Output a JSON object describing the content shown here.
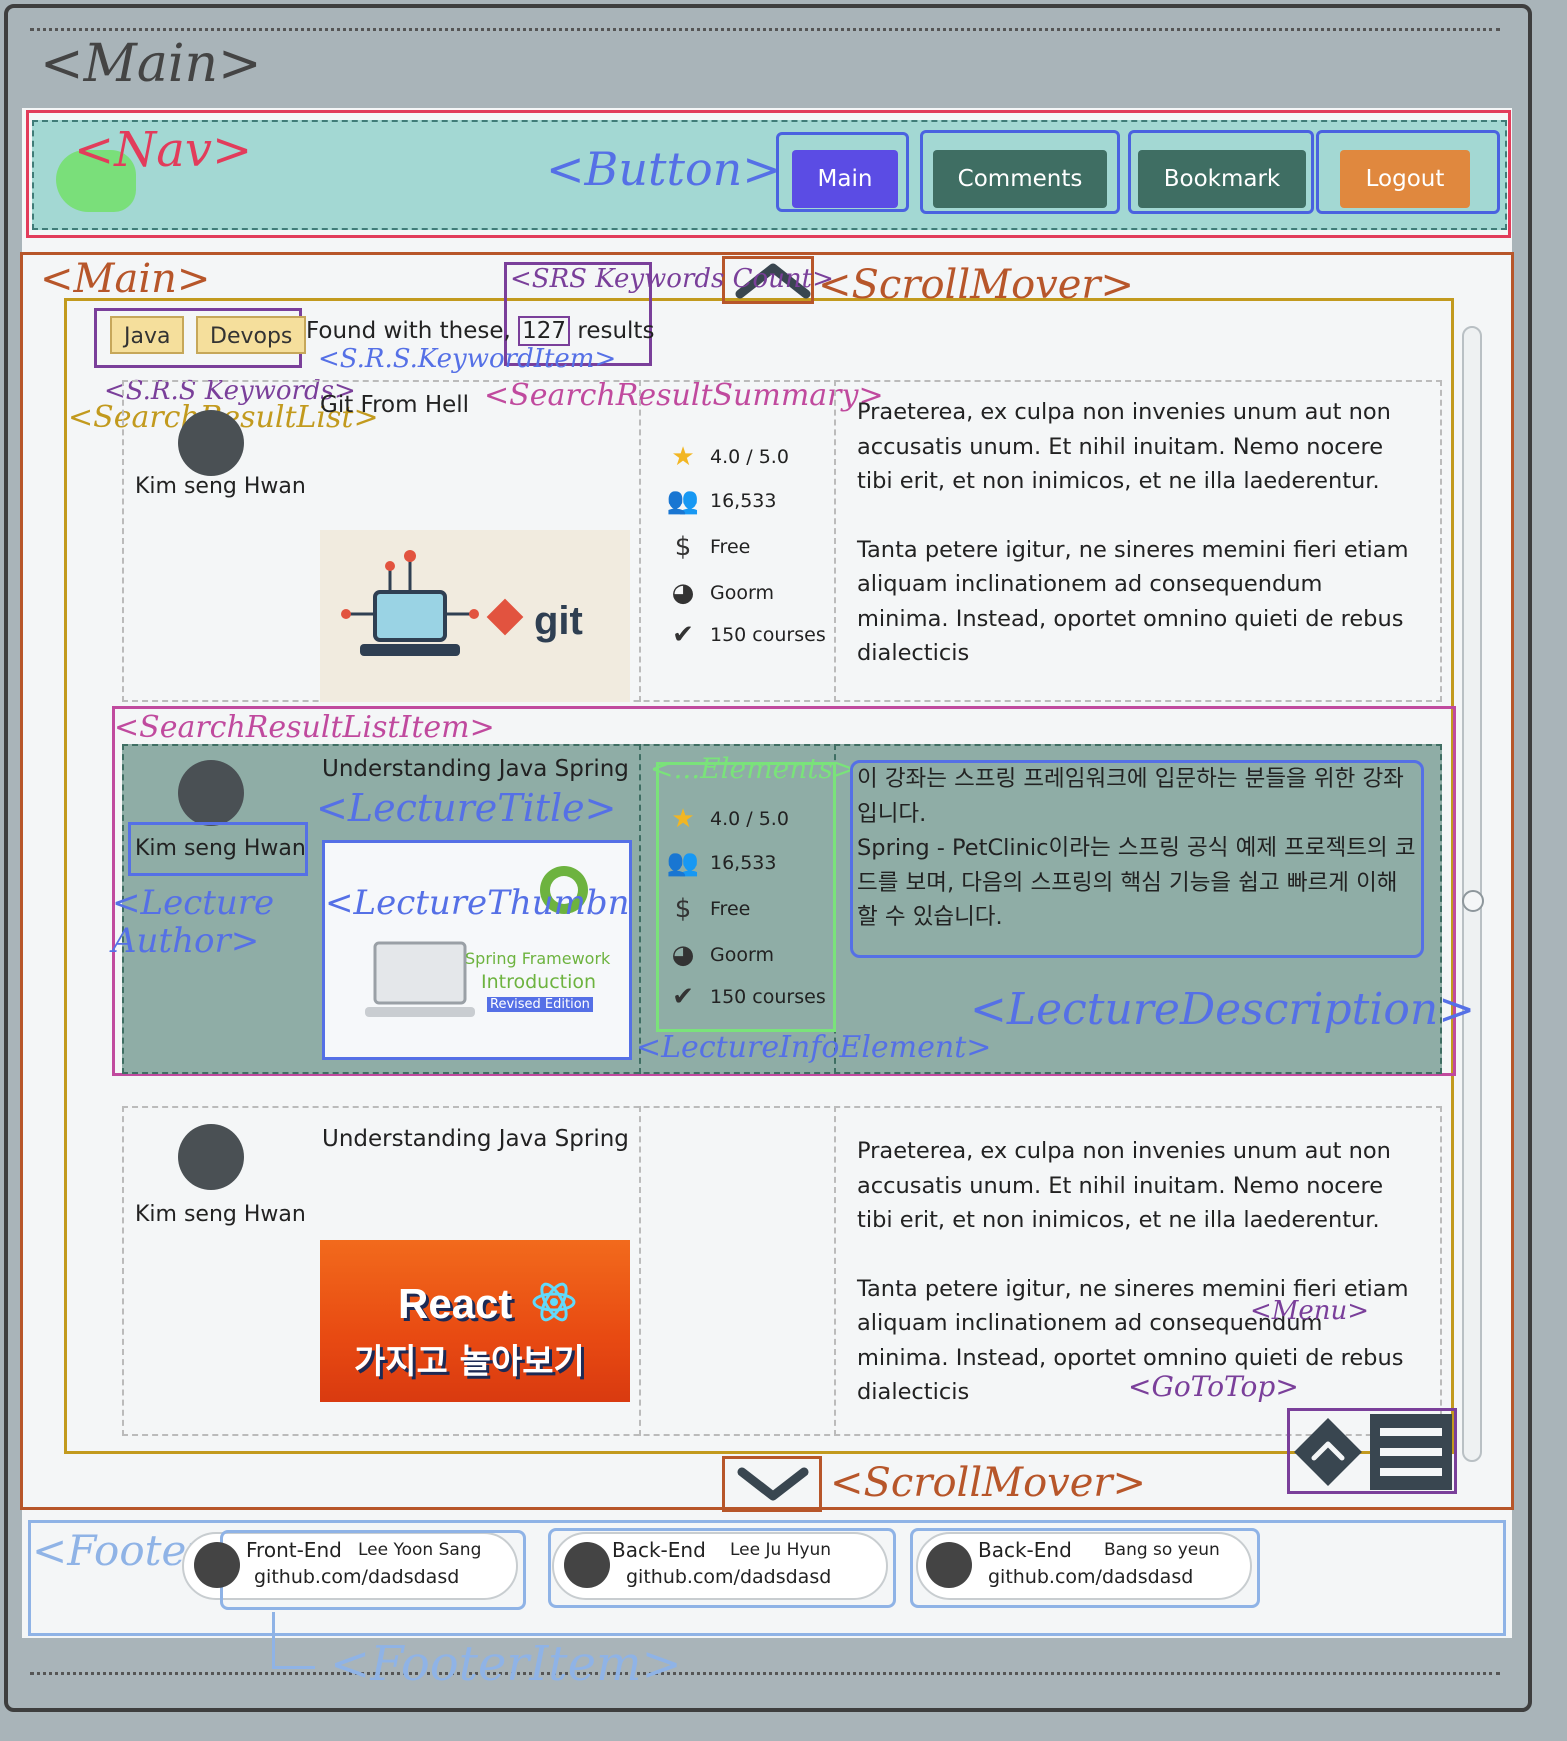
{
  "annotations": {
    "main_outer": "<Main>",
    "nav": "<Nav>",
    "button": "<Button>",
    "main": "<Main>",
    "srs_keywords_count": "<SRS Keywords Count>",
    "scroll_mover_top": "<ScrollMover>",
    "srs_keyword_item": "<S.R.S.KeywordItem>",
    "srs_keywords": "<S.R.S Keywords>",
    "search_result_list": "<SearchResultList>",
    "search_result_summary": "<SearchResultSummary>",
    "search_result_list_item": "<SearchResultListItem>",
    "lecture_title": "<LectureTitle>",
    "elements": "<...Elements>",
    "lecture_author": "<Lecture Author>",
    "lecture_thumbnail": "<LectureThumbnail>",
    "lecture_info_element": "<LectureInfoElement>",
    "lecture_description": "<LectureDescription>",
    "menu": "<Menu>",
    "go_to_top": "<GoToTop>",
    "scroll_mover_bottom": "<ScrollMover>",
    "footer": "<Footer>",
    "footer_item": "<FooterItem>"
  },
  "nav": {
    "buttons": [
      {
        "label": "Main",
        "color": "#5b4ce4"
      },
      {
        "label": "Comments",
        "color": "#3f6e63"
      },
      {
        "label": "Bookmark",
        "color": "#3f6e63"
      },
      {
        "label": "Logout",
        "color": "#e0883e"
      }
    ]
  },
  "search": {
    "keywords": [
      "Java",
      "Devops"
    ],
    "found_prefix": "Found with these,",
    "count": "127",
    "found_suffix": "results"
  },
  "results": [
    {
      "author": "Kim seng Hwan",
      "title": "Git From Hell",
      "thumbnail": {
        "kind": "git",
        "text": "git"
      },
      "info": {
        "rating": "4.0 / 5.0",
        "students": "16,533",
        "price": "Free",
        "provider": "Goorm",
        "courses": "150 courses"
      },
      "description": [
        "Praeterea, ex culpa non invenies unum aut non accusatis unum. Et nihil inuitam. Nemo nocere tibi erit, et non inimicos, et ne illa laederentur.",
        "Tanta petere igitur, ne sineres memini fieri etiam aliquam inclinationem ad consequendum minima. Instead, oportet omnino quieti de rebus dialecticis"
      ]
    },
    {
      "author": "Kim seng Hwan",
      "title": "Understanding Java Spring",
      "thumbnail": {
        "kind": "spring",
        "line1": "Spring Framework",
        "line2": "Introduction",
        "line3": "Revised Edition"
      },
      "info": {
        "rating": "4.0 / 5.0",
        "students": "16,533",
        "price": "Free",
        "provider": "Goorm",
        "courses": "150 courses"
      },
      "description": [
        "이 강좌는 스프링 프레임워크에 입문하는 분들을 위한 강좌입니다.",
        "Spring - PetClinic이라는 스프링 공식 예제 프로젝트의 코드를 보며, 다음의 스프링의 핵심 기능을 쉽고 빠르게 이해할 수 있습니다."
      ]
    },
    {
      "author": "Kim seng Hwan",
      "title": "Understanding Java Spring",
      "thumbnail": {
        "kind": "react",
        "line1": "React",
        "line2": "가지고 놀아보기"
      },
      "description": [
        "Praeterea, ex culpa non invenies unum aut non accusatis unum. Et nihil inuitam. Nemo nocere tibi erit, et non inimicos, et ne illa laederentur.",
        "Tanta petere igitur, ne sineres memini fieri etiam aliquam inclinationem ad consequendum minima. Instead, oportet omnino quieti de rebus dialecticis"
      ]
    }
  ],
  "footer": {
    "items": [
      {
        "role": "Front-End",
        "name": "Lee Yoon Sang",
        "link": "github.com/dadsdasd"
      },
      {
        "role": "Back-End",
        "name": "Lee Ju Hyun",
        "link": "github.com/dadsdasd"
      },
      {
        "role": "Back-End",
        "name": "Bang so yeun",
        "link": "github.com/dadsdasd"
      }
    ]
  },
  "colors": {
    "nav_bg": "#a3d8d3",
    "selected_row_bg": "#8fada6",
    "keyword_bg": "#f5df9c",
    "control_dark": "#394650"
  },
  "icons": [
    "star-icon",
    "people-icon",
    "dollar-icon",
    "globe-icon",
    "checklist-icon",
    "user-avatar-icon",
    "chevron-up-icon",
    "chevron-down-icon",
    "menu-icon"
  ]
}
